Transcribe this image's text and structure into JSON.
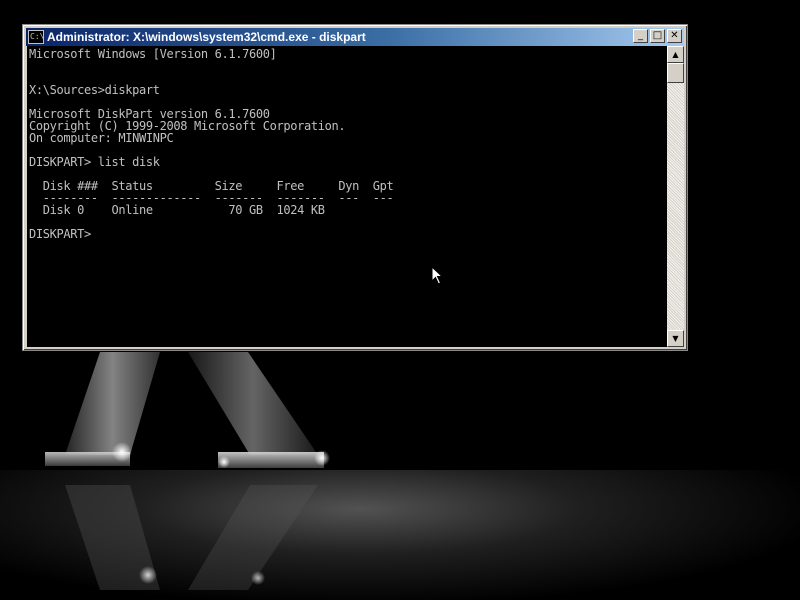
{
  "window": {
    "title": "Administrator: X:\\windows\\system32\\cmd.exe - diskpart",
    "icon": "cmd-icon",
    "icon_text": "C:\\",
    "buttons": {
      "minimize": "_",
      "maximize": "□",
      "close": "✕"
    }
  },
  "console": {
    "text": "Microsoft Windows [Version 6.1.7600]\n\n\nX:\\Sources>diskpart\n\nMicrosoft DiskPart version 6.1.7600\nCopyright (C) 1999-2008 Microsoft Corporation.\nOn computer: MINWINPC\n\nDISKPART> list disk\n\n  Disk ###  Status         Size     Free     Dyn  Gpt\n  --------  -------------  -------  -------  ---  ---\n  Disk 0    Online           70 GB  1024 KB\n\nDISKPART> "
  },
  "scrollbar": {
    "up": "▲",
    "down": "▼"
  },
  "colors": {
    "titlebar_start": "#0a246a",
    "titlebar_end": "#a6caf0",
    "console_bg": "#000000",
    "console_fg": "#c0c0c0"
  }
}
